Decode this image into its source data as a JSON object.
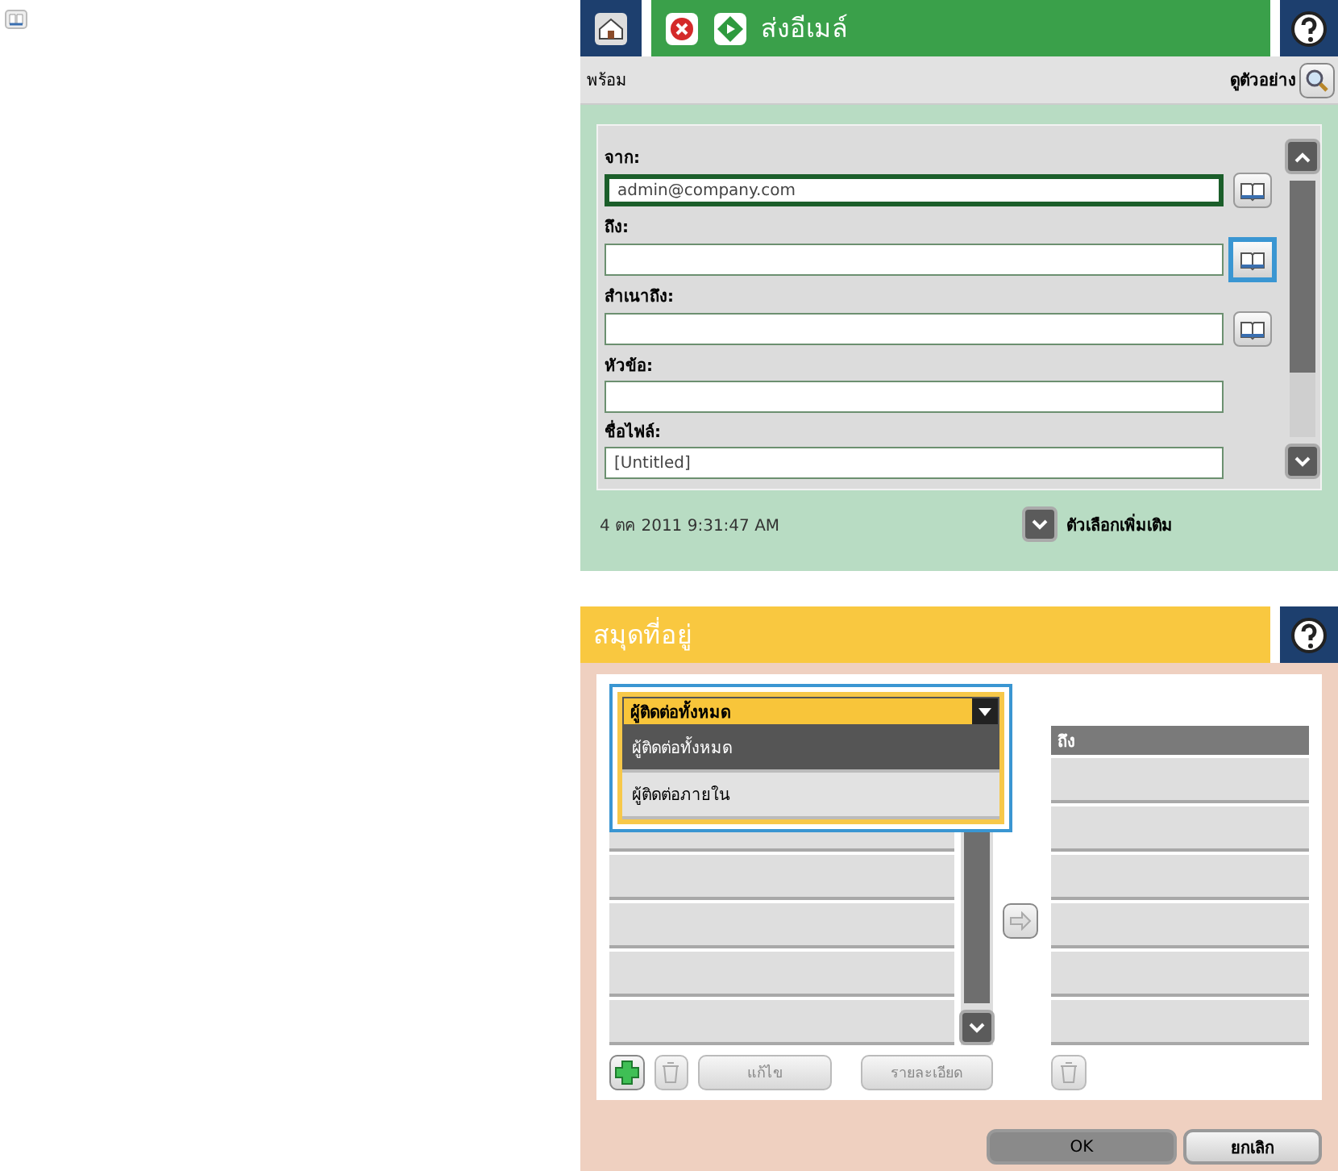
{
  "email_screen": {
    "title": "ส่งอีเมล์",
    "status": "พร้อม",
    "preview_label": "ดูตัวอย่าง",
    "fields": [
      {
        "label": "จาก:",
        "value": "admin@company.com",
        "focused": true,
        "address_book": {
          "highlighted": false
        }
      },
      {
        "label": "ถึง:",
        "focused": false,
        "address_book": {
          "highlighted": true
        }
      },
      {
        "label": "สำเนาถึง:",
        "focused": false,
        "address_book": {
          "highlighted": false
        }
      },
      {
        "label": "หัวข้อ:",
        "focused": false
      },
      {
        "label": "ชื่อไฟล์:",
        "value": "[Untitled]",
        "focused": false
      }
    ],
    "datetime": "4 ตค 2011 9:31:47 AM",
    "more_options": "ตัวเลือกเพิ่มเติม"
  },
  "address_book_screen": {
    "title": "สมุดที่อยู่",
    "dropdown": {
      "value": "ผู้ติดต่อทั้งหมด",
      "expanded": true,
      "options": [
        {
          "label": "ผู้ติดต่อทั้งหมด",
          "selected": true
        },
        {
          "label": "ผู้ติดต่อภายใน",
          "selected": false
        }
      ]
    },
    "recipients_header": "ถึง",
    "buttons": [
      {
        "kind": "add",
        "disabled": false
      },
      {
        "kind": "delete",
        "disabled": true
      },
      {
        "kind": "text",
        "label": "แก้ไข",
        "disabled": true
      },
      {
        "kind": "text",
        "label": "รายละเอียด",
        "disabled": true
      }
    ],
    "ok": "OK",
    "cancel": "ยกเลิก"
  }
}
